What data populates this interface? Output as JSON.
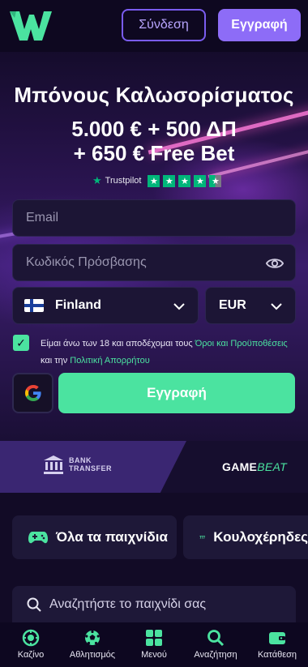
{
  "header": {
    "login_label": "Σύνδεση",
    "register_label": "Εγγραφή"
  },
  "hero": {
    "title": "Μπόνους Καλωσορίσματος",
    "line1": "5.000 € + 500 ΔΠ",
    "line2": "+ 650 € Free Bet",
    "trustpilot_label": "Trustpilot",
    "trustpilot_rating": 4.5
  },
  "form": {
    "email_placeholder": "Email",
    "password_placeholder": "Κωδικός Πρόσβασης",
    "country_value": "Finland",
    "currency_value": "EUR",
    "terms_prefix": "Είμαι άνω των 18 και αποδέχομαι τους ",
    "terms_link": "Όροι και Προϋποθέσεις",
    "terms_mid": " και την ",
    "privacy_link": "Πολιτική Απορρήτου",
    "register_label": "Εγγραφή"
  },
  "payments": {
    "bank_line1": "BANK",
    "bank_line2": "TRANSFER",
    "gamebeat_main": "GAME",
    "gamebeat_accent": "BEAT"
  },
  "categories": {
    "all_games": "Όλα τα παιχνίδια",
    "slots": "Κουλοχέρηδες"
  },
  "search": {
    "placeholder": "Αναζητήστε το παιχνίδι σας"
  },
  "bottom_nav": {
    "casino": "Καζίνο",
    "sports": "Αθλητισμός",
    "menu": "Μενού",
    "search": "Αναζήτηση",
    "deposit": "Κατάθεση"
  },
  "colors": {
    "accent_green": "#4be3a0",
    "accent_purple": "#8d6cf7",
    "background": "#120b26"
  }
}
